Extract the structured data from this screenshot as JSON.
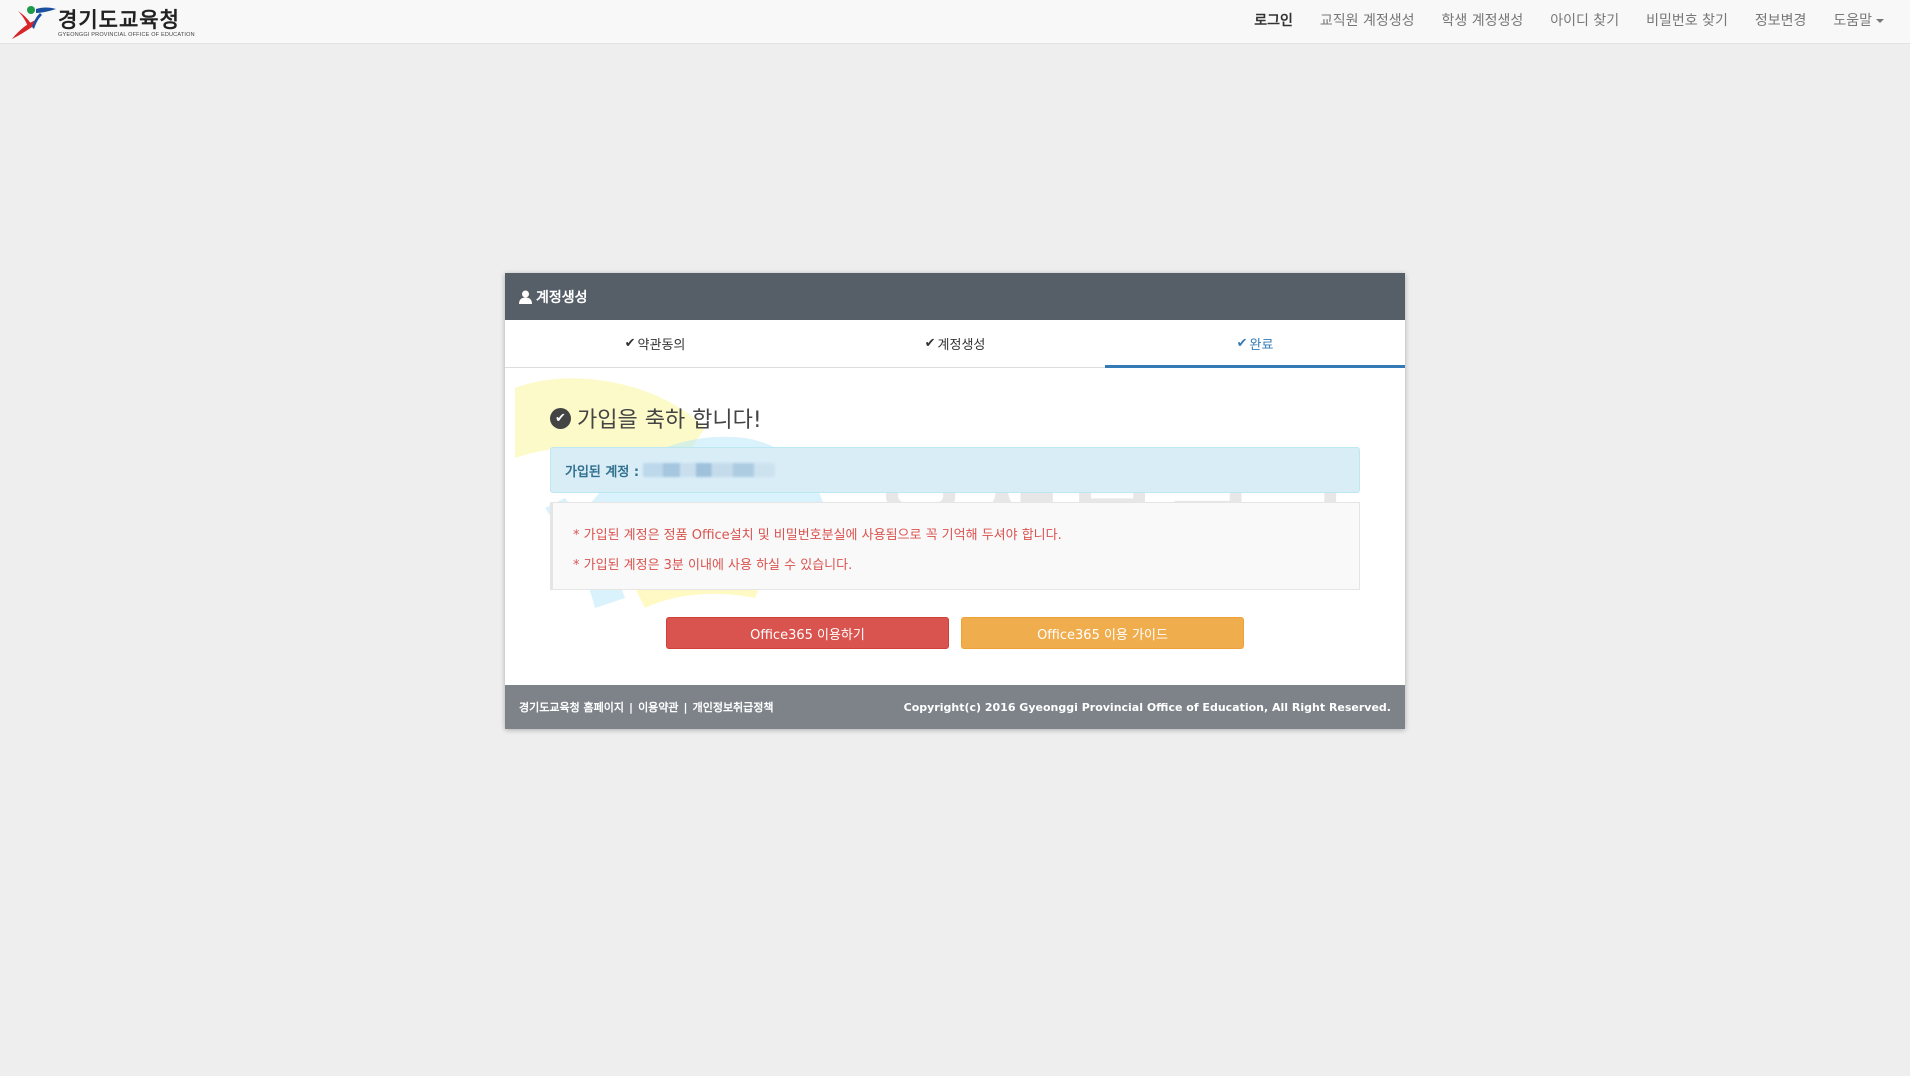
{
  "brand": {
    "name": "경기도교육청",
    "sub": "GYEONGGI PROVINCIAL OFFICE OF EDUCATION"
  },
  "nav": {
    "items": [
      {
        "label": "로그인"
      },
      {
        "label": "교직원 계정생성"
      },
      {
        "label": "학생 계정생성"
      },
      {
        "label": "아이디 찾기"
      },
      {
        "label": "비밀번호 찾기"
      },
      {
        "label": "정보변경"
      },
      {
        "label": "도움말"
      }
    ]
  },
  "panel": {
    "heading": "계정생성",
    "steps": [
      {
        "label": "약관동의"
      },
      {
        "label": "계정생성"
      },
      {
        "label": "완료"
      }
    ],
    "success_title": "가입을 축하 합니다!",
    "account_label": "가입된 계정 :",
    "notices": [
      "* 가입된 계정은 정품 Office설치 및 비밀번호분실에 사용됨으로 꼭 기억해 두셔야 합니다.",
      "* 가입된 계정은 3분 이내에 사용 하실 수 있습니다."
    ],
    "buttons": {
      "use": "Office365 이용하기",
      "guide": "Office365 이용 가이드"
    },
    "watermark_text": "은성블로그"
  },
  "footer": {
    "links": [
      {
        "label": "경기도교육청 홈페이지"
      },
      {
        "label": "이용약관"
      },
      {
        "label": "개인정보취급정책"
      }
    ],
    "separator": "|",
    "copyright": "Copyright(c) 2016 Gyeonggi Provincial Office of Education, All Right Reserved."
  },
  "colors": {
    "heading_bg": "#565e67",
    "active_step": "#337ab7",
    "danger": "#d9534f",
    "warning": "#f0ad4e",
    "footer_bg": "#7e8389"
  }
}
